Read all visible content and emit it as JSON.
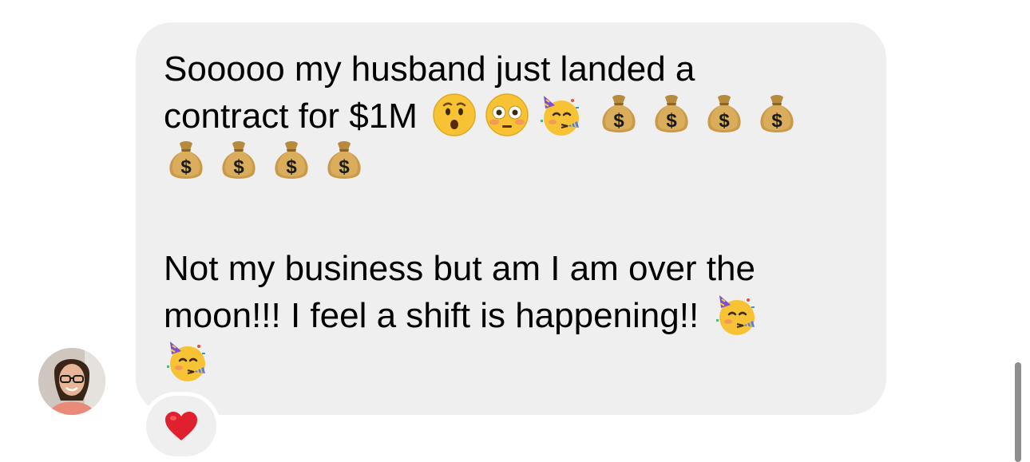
{
  "message": {
    "lines": [
      "Sooooo my husband just landed a",
      "contract for $1M",
      "",
      "Not my business but am I am over the",
      "moon!!! I feel a shift is happening!!"
    ],
    "emojis_line2": [
      "hushed-face",
      "flushed-face",
      "partying-face",
      "money-bag",
      "money-bag",
      "money-bag",
      "money-bag"
    ],
    "emojis_line3": [
      "money-bag",
      "money-bag",
      "money-bag",
      "money-bag"
    ],
    "emojis_line5": [
      "partying-face"
    ],
    "emojis_line6": [
      "partying-face"
    ]
  },
  "reaction": {
    "icon": "red-heart"
  },
  "colors": {
    "bubble": "#efefef",
    "text": "#000000",
    "heart": "#e0202e",
    "scrollbar": "#8e8e8e"
  }
}
